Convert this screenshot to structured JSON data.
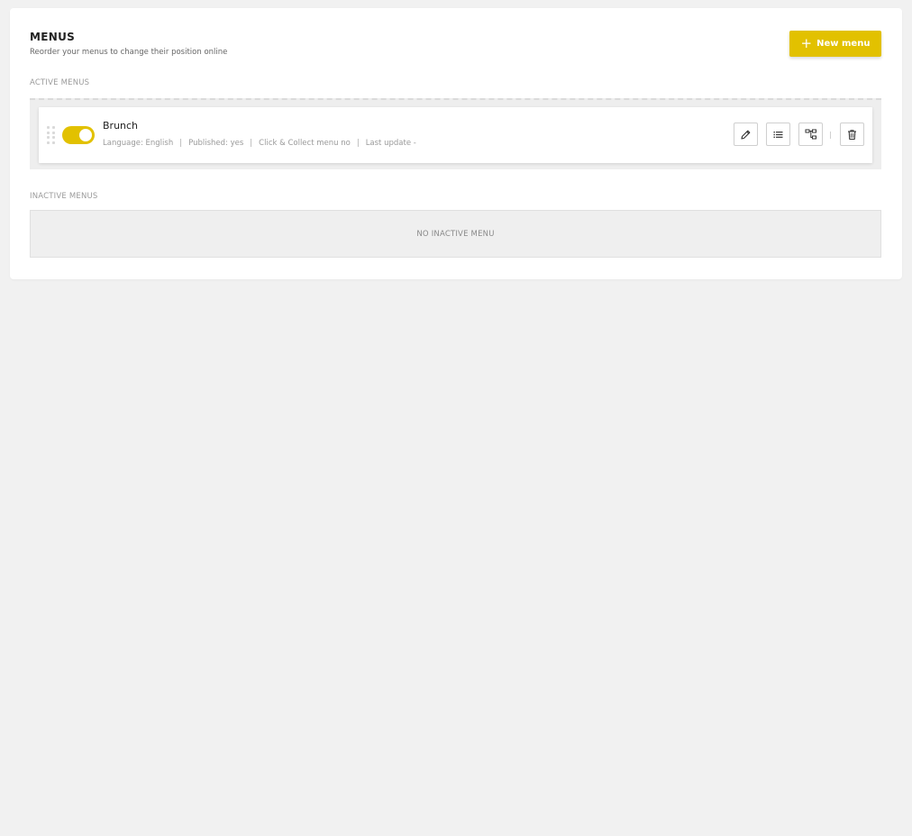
{
  "header": {
    "title": "MENUS",
    "subtitle": "Reorder your menus to change their position online",
    "new_button_label": "New menu"
  },
  "sections": {
    "active_label": "ACTIVE MENUS",
    "inactive_label": "INACTIVE MENUS",
    "inactive_empty": "NO INACTIVE MENU"
  },
  "active_menus": [
    {
      "name": "Brunch",
      "enabled": true,
      "language": "Language: English",
      "published": "Published: yes",
      "click_collect": "Click & Collect menu no",
      "last_update": "Last update -",
      "separator": "|"
    }
  ],
  "icons": {
    "add": "plus-icon",
    "drag": "drag-handle-icon",
    "edit": "pencil-icon",
    "list": "list-icon",
    "structure": "tree-icon",
    "delete": "trash-icon"
  },
  "colors": {
    "accent": "#e2c100",
    "background": "#f1f1f1",
    "card": "#ffffff"
  }
}
